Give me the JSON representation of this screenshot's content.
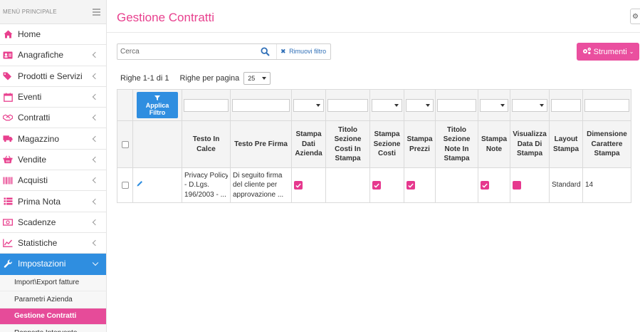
{
  "sidebar": {
    "header": "MENÙ PRINCIPALE",
    "items": [
      {
        "label": "Home",
        "icon": "home-icon",
        "has_children": false
      },
      {
        "label": "Anagrafiche",
        "icon": "contact-card-icon",
        "has_children": true
      },
      {
        "label": "Prodotti e Servizi",
        "icon": "tags-icon",
        "has_children": true
      },
      {
        "label": "Eventi",
        "icon": "calendar-icon",
        "has_children": true
      },
      {
        "label": "Contratti",
        "icon": "handshake-icon",
        "has_children": true
      },
      {
        "label": "Magazzino",
        "icon": "truck-icon",
        "has_children": true
      },
      {
        "label": "Vendite",
        "icon": "shopping-basket-icon",
        "has_children": true
      },
      {
        "label": "Acquisti",
        "icon": "barcode-icon",
        "has_children": true
      },
      {
        "label": "Prima Nota",
        "icon": "list-icon",
        "has_children": true
      },
      {
        "label": "Scadenze",
        "icon": "money-icon",
        "has_children": true
      },
      {
        "label": "Statistiche",
        "icon": "line-chart-icon",
        "has_children": true
      },
      {
        "label": "Impostazioni",
        "icon": "wrench-icon",
        "has_children": true,
        "active": true
      }
    ],
    "subitems": [
      "Import\\Export fatture",
      "Parametri Azienda",
      "Gestione Contratti",
      "Rapporto Intervento"
    ],
    "selected_subitem": "Gestione Contratti"
  },
  "header": {
    "title": "Gestione Contratti"
  },
  "search": {
    "placeholder": "Cerca",
    "remove_filter": "Rimuovi filtro"
  },
  "tools_button": "Strumenti",
  "pager": {
    "rows_info": "Righe 1-1 di 1",
    "per_page_label": "Righe per pagina",
    "per_page_value": "25"
  },
  "grid": {
    "apply_filter_line1": "Applica",
    "apply_filter_line2": "Filtro",
    "columns": [
      "Testo In Calce",
      "Testo Pre Firma",
      "Stampa Dati Azienda",
      "Titolo Sezione Costi In Stampa",
      "Stampa Sezione Costi",
      "Stampa Prezzi",
      "Titolo Sezione Note In Stampa",
      "Stampa Note",
      "Visualizza Data Di Stampa",
      "Layout Stampa",
      "Dimensione Carattere Stampa"
    ],
    "rows": [
      {
        "testo_in_calce": [
          "Privacy Policy",
          "- D.Lgs.",
          "196/2003 - ..."
        ],
        "testo_pre_firma": [
          "Di seguito firma",
          "del cliente per",
          "approvazione ..."
        ],
        "stampa_dati_azienda": true,
        "titolo_sezione_costi": "",
        "stampa_sezione_costi": true,
        "stampa_prezzi": true,
        "titolo_sezione_note": "",
        "stampa_note": true,
        "visualizza_data": false,
        "layout_stampa": "Standard",
        "dimensione_carattere": "14"
      }
    ]
  },
  "colors": {
    "accent": "#e8408e",
    "primary_blue": "#2f8ee0",
    "link": "#2f6fb7"
  }
}
